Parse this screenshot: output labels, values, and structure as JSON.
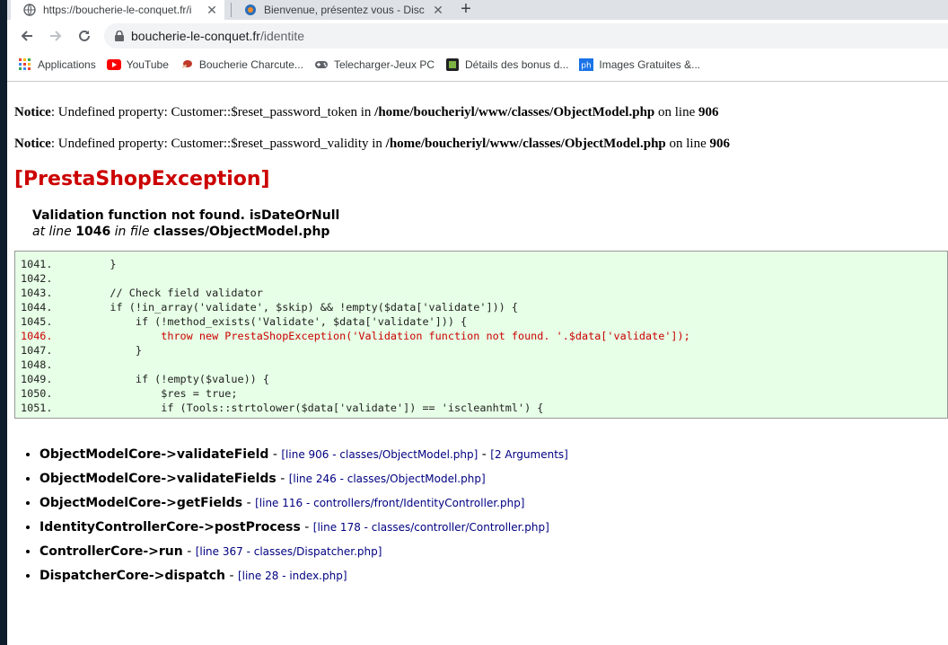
{
  "browser": {
    "tabs": [
      {
        "title": "https://boucherie-le-conquet.fr/i",
        "active": true,
        "close_glyph": "✕"
      },
      {
        "title": "Bienvenue, présentez vous - Disc",
        "active": false,
        "close_glyph": "✕"
      }
    ],
    "new_tab_glyph": "+",
    "address": {
      "host": "boucherie-le-conquet.fr",
      "path": "/identite"
    },
    "bookmarks": [
      {
        "label": "Applications",
        "icon": "apps-grid-icon"
      },
      {
        "label": "YouTube",
        "icon": "youtube-icon"
      },
      {
        "label": "Boucherie Charcute...",
        "icon": "meat-icon"
      },
      {
        "label": "Telecharger-Jeux PC",
        "icon": "gamepad-icon"
      },
      {
        "label": "Détails des bonus d...",
        "icon": "bonus-icon"
      },
      {
        "label": "Images Gratuites &...",
        "icon": "ph-icon"
      }
    ]
  },
  "notices": [
    {
      "label": "Notice",
      "text": ": Undefined property: Customer::$reset_password_token in ",
      "path": "/home/boucheriyl/www/classes/ObjectModel.php",
      "on_line": " on line ",
      "line": "906"
    },
    {
      "label": "Notice",
      "text": ": Undefined property: Customer::$reset_password_validity in ",
      "path": "/home/boucheriyl/www/classes/ObjectModel.php",
      "on_line": " on line ",
      "line": "906"
    }
  ],
  "exception": {
    "title": "[PrestaShopException]",
    "message": "Validation function not found. isDateOrNull",
    "at_line_prefix": "at line",
    "line": "1046",
    "in_file": "in file",
    "file": "classes/ObjectModel.php"
  },
  "code_lines": [
    {
      "text": "1041.         }",
      "error": false
    },
    {
      "text": "1042.",
      "error": false
    },
    {
      "text": "1043.         // Check field validator",
      "error": false
    },
    {
      "text": "1044.         if (!in_array('validate', $skip) && !empty($data['validate'])) {",
      "error": false
    },
    {
      "text": "1045.             if (!method_exists('Validate', $data['validate'])) {",
      "error": false
    },
    {
      "text": "1046.                 throw new PrestaShopException('Validation function not found. '.$data['validate']);",
      "error": true
    },
    {
      "text": "1047.             }",
      "error": false
    },
    {
      "text": "1048.",
      "error": false
    },
    {
      "text": "1049.             if (!empty($value)) {",
      "error": false
    },
    {
      "text": "1050.                 $res = true;",
      "error": false
    },
    {
      "text": "1051.                 if (Tools::strtolower($data['validate']) == 'iscleanhtml') {",
      "error": false
    }
  ],
  "trace": [
    {
      "fn": "ObjectModelCore->validateField",
      "sep": " - ",
      "src": "[line 906 - classes/ObjectModel.php]",
      "extra": "[2 Arguments]"
    },
    {
      "fn": "ObjectModelCore->validateFields",
      "sep": " - ",
      "src": "[line 246 - classes/ObjectModel.php]",
      "extra": ""
    },
    {
      "fn": "ObjectModelCore->getFields",
      "sep": " - ",
      "src": "[line 116 - controllers/front/IdentityController.php]",
      "extra": ""
    },
    {
      "fn": "IdentityControllerCore->postProcess",
      "sep": " - ",
      "src": "[line 178 - classes/controller/Controller.php]",
      "extra": ""
    },
    {
      "fn": "ControllerCore->run",
      "sep": " - ",
      "src": "[line 367 - classes/Dispatcher.php]",
      "extra": ""
    },
    {
      "fn": "DispatcherCore->dispatch",
      "sep": " - ",
      "src": "[line 28 - index.php]",
      "extra": ""
    }
  ]
}
